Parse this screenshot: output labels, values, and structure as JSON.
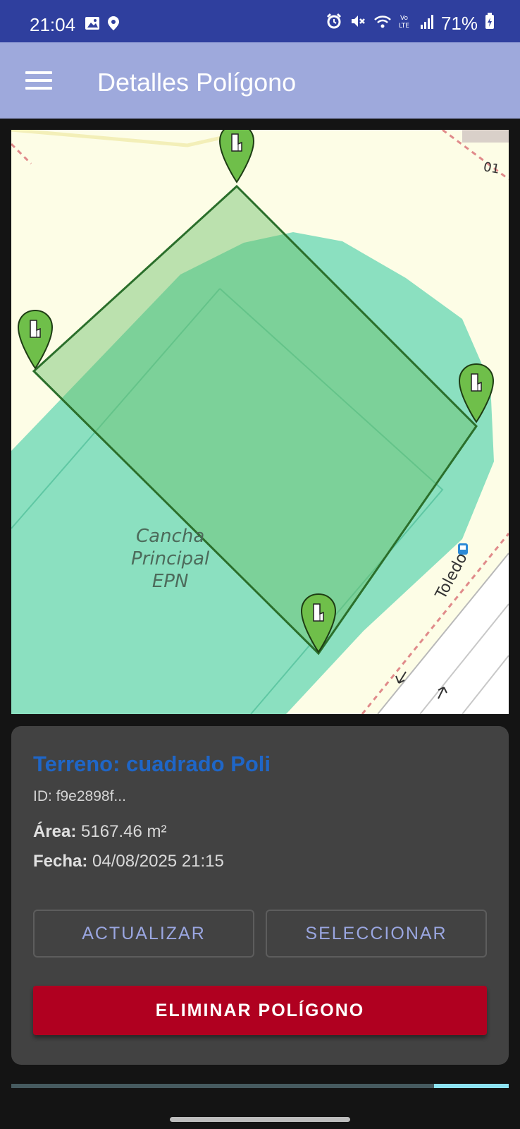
{
  "status_bar": {
    "time": "21:04",
    "battery": "71%",
    "icons": [
      "image-icon",
      "location-icon",
      "alarm-icon",
      "mute-icon",
      "wifi-icon",
      "volte-icon",
      "signal-icon",
      "battery-icon"
    ]
  },
  "app_bar": {
    "title": "Detalles Polígono",
    "menu_icon": "menu-icon"
  },
  "map": {
    "place_label_lines": [
      "Cancha",
      "Principal",
      "EPN"
    ],
    "road_label": "Toledo",
    "corner_label": "01",
    "marker_count": 4,
    "marker_icon": "pointing-hand-marker-icon",
    "colors": {
      "background": "#fdfde6",
      "park": "#8be0c0",
      "polygon_fill": "#6bbf6b",
      "polygon_stroke": "#2b6f2b",
      "marker": "#6fbf4a"
    }
  },
  "details": {
    "title": "Terreno: cuadrado Poli",
    "id": "ID: f9e2898f...",
    "area_label": "Área:",
    "area_value": "5167.46 m²",
    "date_label": "Fecha:",
    "date_value": "04/08/2025 21:15"
  },
  "actions": {
    "update_label": "ACTUALIZAR",
    "select_label": "SELECCIONAR",
    "delete_label": "ELIMINAR POLÍGONO"
  },
  "colors": {
    "status_bar": "#2f3f9e",
    "app_bar": "#9ea9dc",
    "title_accent": "#1f66c7",
    "delete_button": "#b00020",
    "outline_text": "#9aa6e0"
  }
}
